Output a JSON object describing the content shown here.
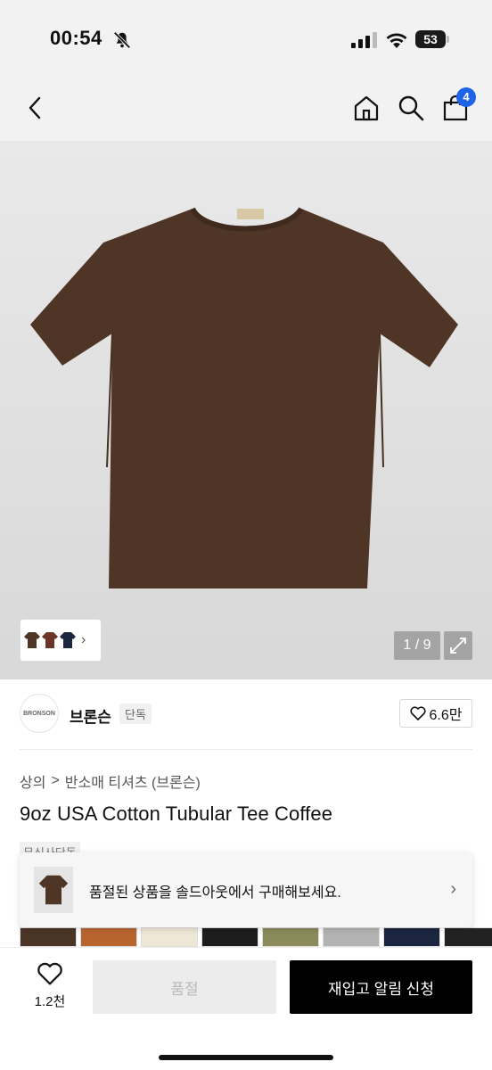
{
  "status_bar": {
    "time": "00:54",
    "battery": "53"
  },
  "nav": {
    "cart_count": "4"
  },
  "hero": {
    "pager": "1 / 9"
  },
  "brand": {
    "logo_text": "BRONSON",
    "name": "브론슨",
    "tag": "단독",
    "likes": "6.6만"
  },
  "breadcrumb": {
    "level1": "상의",
    "separator": ">",
    "level2": "반소매 티셔츠 (브론슨)"
  },
  "product": {
    "title": "9oz USA Cotton Tubular Tee Coffee",
    "exclusive_label": "무신사단독"
  },
  "toast": {
    "message": "품절된 상품을 솔드아웃에서 구매해보세요."
  },
  "swatch_colors": [
    "#4a3426",
    "#b8652f",
    "#efe7d6",
    "#1d1d1d",
    "#8a8a5a",
    "#b3b3b3",
    "#1d2640",
    "#222222"
  ],
  "bottom": {
    "wish_count": "1.2천",
    "soldout_label": "품절",
    "restock_label": "재입고 알림 신청"
  },
  "colors": {
    "shirt": "#4e3526",
    "accent": "#1e63e9"
  }
}
